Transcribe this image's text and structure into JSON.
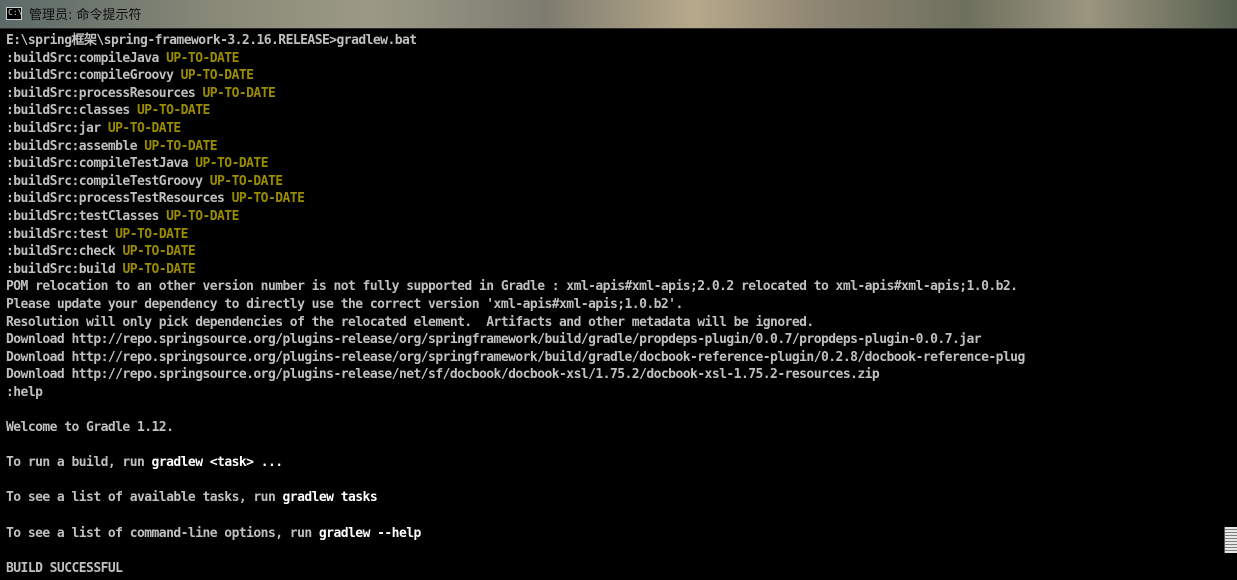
{
  "window": {
    "icon_text": "C:\\",
    "title": "管理员: 命令提示符"
  },
  "console": {
    "lines": [
      {
        "text": "E:\\spring框架\\spring-framework-3.2.16.RELEASE>gradlew.bat",
        "status": "",
        "cmd": ""
      },
      {
        "text": ":buildSrc:compileJava ",
        "status": "UP-TO-DATE",
        "cmd": ""
      },
      {
        "text": ":buildSrc:compileGroovy ",
        "status": "UP-TO-DATE",
        "cmd": ""
      },
      {
        "text": ":buildSrc:processResources ",
        "status": "UP-TO-DATE",
        "cmd": ""
      },
      {
        "text": ":buildSrc:classes ",
        "status": "UP-TO-DATE",
        "cmd": ""
      },
      {
        "text": ":buildSrc:jar ",
        "status": "UP-TO-DATE",
        "cmd": ""
      },
      {
        "text": ":buildSrc:assemble ",
        "status": "UP-TO-DATE",
        "cmd": ""
      },
      {
        "text": ":buildSrc:compileTestJava ",
        "status": "UP-TO-DATE",
        "cmd": ""
      },
      {
        "text": ":buildSrc:compileTestGroovy ",
        "status": "UP-TO-DATE",
        "cmd": ""
      },
      {
        "text": ":buildSrc:processTestResources ",
        "status": "UP-TO-DATE",
        "cmd": ""
      },
      {
        "text": ":buildSrc:testClasses ",
        "status": "UP-TO-DATE",
        "cmd": ""
      },
      {
        "text": ":buildSrc:test ",
        "status": "UP-TO-DATE",
        "cmd": ""
      },
      {
        "text": ":buildSrc:check ",
        "status": "UP-TO-DATE",
        "cmd": ""
      },
      {
        "text": ":buildSrc:build ",
        "status": "UP-TO-DATE",
        "cmd": ""
      },
      {
        "text": "POM relocation to an other version number is not fully supported in Gradle : xml-apis#xml-apis;2.0.2 relocated to xml-apis#xml-apis;1.0.b2.",
        "status": "",
        "cmd": ""
      },
      {
        "text": "Please update your dependency to directly use the correct version 'xml-apis#xml-apis;1.0.b2'.",
        "status": "",
        "cmd": ""
      },
      {
        "text": "Resolution will only pick dependencies of the relocated element.  Artifacts and other metadata will be ignored.",
        "status": "",
        "cmd": ""
      },
      {
        "text": "Download http://repo.springsource.org/plugins-release/org/springframework/build/gradle/propdeps-plugin/0.0.7/propdeps-plugin-0.0.7.jar",
        "status": "",
        "cmd": ""
      },
      {
        "text": "Download http://repo.springsource.org/plugins-release/org/springframework/build/gradle/docbook-reference-plugin/0.2.8/docbook-reference-plug",
        "status": "",
        "cmd": ""
      },
      {
        "text": "Download http://repo.springsource.org/plugins-release/net/sf/docbook/docbook-xsl/1.75.2/docbook-xsl-1.75.2-resources.zip",
        "status": "",
        "cmd": ""
      },
      {
        "text": ":help",
        "status": "",
        "cmd": ""
      },
      {
        "text": "",
        "status": "",
        "cmd": ""
      },
      {
        "text": "Welcome to Gradle 1.12.",
        "status": "",
        "cmd": ""
      },
      {
        "text": "",
        "status": "",
        "cmd": ""
      },
      {
        "text": "To run a build, run ",
        "status": "",
        "cmd": "gradlew <task> ..."
      },
      {
        "text": "",
        "status": "",
        "cmd": ""
      },
      {
        "text": "To see a list of available tasks, run ",
        "status": "",
        "cmd": "gradlew tasks"
      },
      {
        "text": "",
        "status": "",
        "cmd": ""
      },
      {
        "text": "To see a list of command-line options, run ",
        "status": "",
        "cmd": "gradlew --help"
      },
      {
        "text": "",
        "status": "",
        "cmd": ""
      },
      {
        "text": "BUILD SUCCESSFUL",
        "status": "",
        "cmd": ""
      }
    ]
  },
  "colors": {
    "background": "#000000",
    "text": "#c0c0c0",
    "status": "#9a8c00",
    "command": "#ffffff"
  }
}
